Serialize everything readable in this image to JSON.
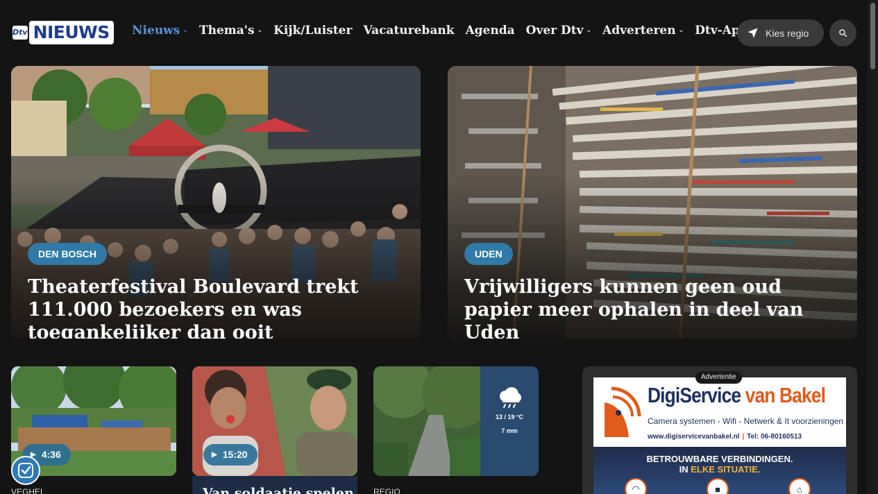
{
  "header": {
    "logo_small": "Dtv",
    "logo_text": "NIEUWS",
    "menu": [
      {
        "label": "Nieuws",
        "dropdown": true,
        "active": true
      },
      {
        "label": "Thema's",
        "dropdown": true
      },
      {
        "label": "Kijk/Luister"
      },
      {
        "label": "Vacaturebank"
      },
      {
        "label": "Agenda"
      },
      {
        "label": "Over Dtv",
        "dropdown": true
      },
      {
        "label": "Adverteren",
        "dropdown": true
      },
      {
        "label": "Dtv-App"
      }
    ],
    "region_button": "Kies regio",
    "chevron": "⌄",
    "colors": {
      "active": "#5b93d8",
      "background": "#141414",
      "tag": "#2f7aa6"
    }
  },
  "hero": [
    {
      "tag": "Den Bosch",
      "title": "Theaterfestival Boulevard trekt 111.000 bezoekers en was toegankelijker dan ooit"
    },
    {
      "tag": "Uden",
      "title": "Vrijwilligers kunnen geen oud papier meer ophalen in deel van Uden"
    }
  ],
  "cards": [
    {
      "duration": "4:36",
      "label": "VEGHEL"
    },
    {
      "duration": "15:20",
      "title": "Van soldaatje spelen"
    },
    {
      "weather": {
        "temp": "13 / 19 °C",
        "rain": "7 mm",
        "icon": "rain-cloud-icon"
      },
      "label": "REGIO"
    }
  ],
  "ad": {
    "label": "Advertentie",
    "brand_a": "DigiService",
    "brand_b": " van Bakel",
    "sub": "Camera systemen  -  Wifi - Netwerk & It voorzieningen",
    "url": "www.digiservicevanbakel.nl",
    "phone": "Tel: 06-80160513",
    "slogan_1": "BETROUWBARE VERBINDINGEN.",
    "slogan_2a": "IN ",
    "slogan_2b": "ELKE SITUATIE."
  }
}
